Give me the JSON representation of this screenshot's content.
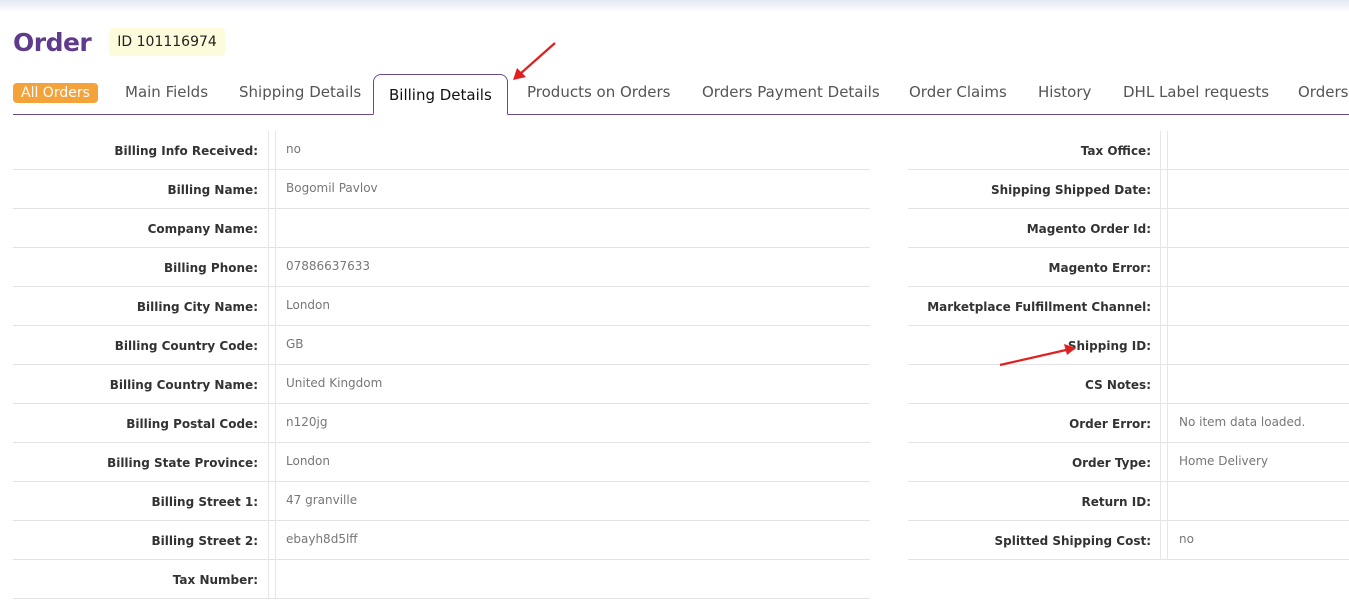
{
  "page": {
    "title": "Order",
    "order_id": "ID 101116974"
  },
  "tabs": [
    {
      "label": "All Orders"
    },
    {
      "label": "Main Fields"
    },
    {
      "label": "Shipping Details"
    },
    {
      "label": "Billing Details"
    },
    {
      "label": "Products on Orders"
    },
    {
      "label": "Orders Payment Details"
    },
    {
      "label": "Order Claims"
    },
    {
      "label": "History"
    },
    {
      "label": "DHL Label requests"
    },
    {
      "label": "Orders"
    }
  ],
  "active_tab": "Billing Details",
  "left_fields": [
    {
      "label": "Billing Info Received:",
      "value": "no"
    },
    {
      "label": "Billing Name:",
      "value": "Bogomil Pavlov"
    },
    {
      "label": "Company Name:",
      "value": ""
    },
    {
      "label": "Billing Phone:",
      "value": "07886637633"
    },
    {
      "label": "Billing City Name:",
      "value": "London"
    },
    {
      "label": "Billing Country Code:",
      "value": "GB"
    },
    {
      "label": "Billing Country Name:",
      "value": "United Kingdom"
    },
    {
      "label": "Billing Postal Code:",
      "value": "n120jg"
    },
    {
      "label": "Billing State Province:",
      "value": "London"
    },
    {
      "label": "Billing Street 1:",
      "value": "47 granville"
    },
    {
      "label": "Billing Street 2:",
      "value": "ebayh8d5lff"
    },
    {
      "label": "Tax Number:",
      "value": ""
    }
  ],
  "right_fields": [
    {
      "label": "Tax Office:",
      "value": ""
    },
    {
      "label": "Shipping Shipped Date:",
      "value": ""
    },
    {
      "label": "Magento Order Id:",
      "value": ""
    },
    {
      "label": "Magento Error:",
      "value": ""
    },
    {
      "label": "Marketplace Fulfillment Channel:",
      "value": ""
    },
    {
      "label": "Shipping ID:",
      "value": ""
    },
    {
      "label": "CS Notes:",
      "value": ""
    },
    {
      "label": "Order Error:",
      "value": "No item data loaded."
    },
    {
      "label": "Order Type:",
      "value": "Home Delivery"
    },
    {
      "label": "Return ID:",
      "value": ""
    },
    {
      "label": "Splitted Shipping Cost:",
      "value": "no"
    }
  ],
  "colors": {
    "title": "#5f3b8c",
    "accent_orange": "#f4a23a",
    "tab_border": "#6b4b8f",
    "id_badge_bg": "#fdfbdc",
    "annotation_arrow": "#e02020"
  }
}
